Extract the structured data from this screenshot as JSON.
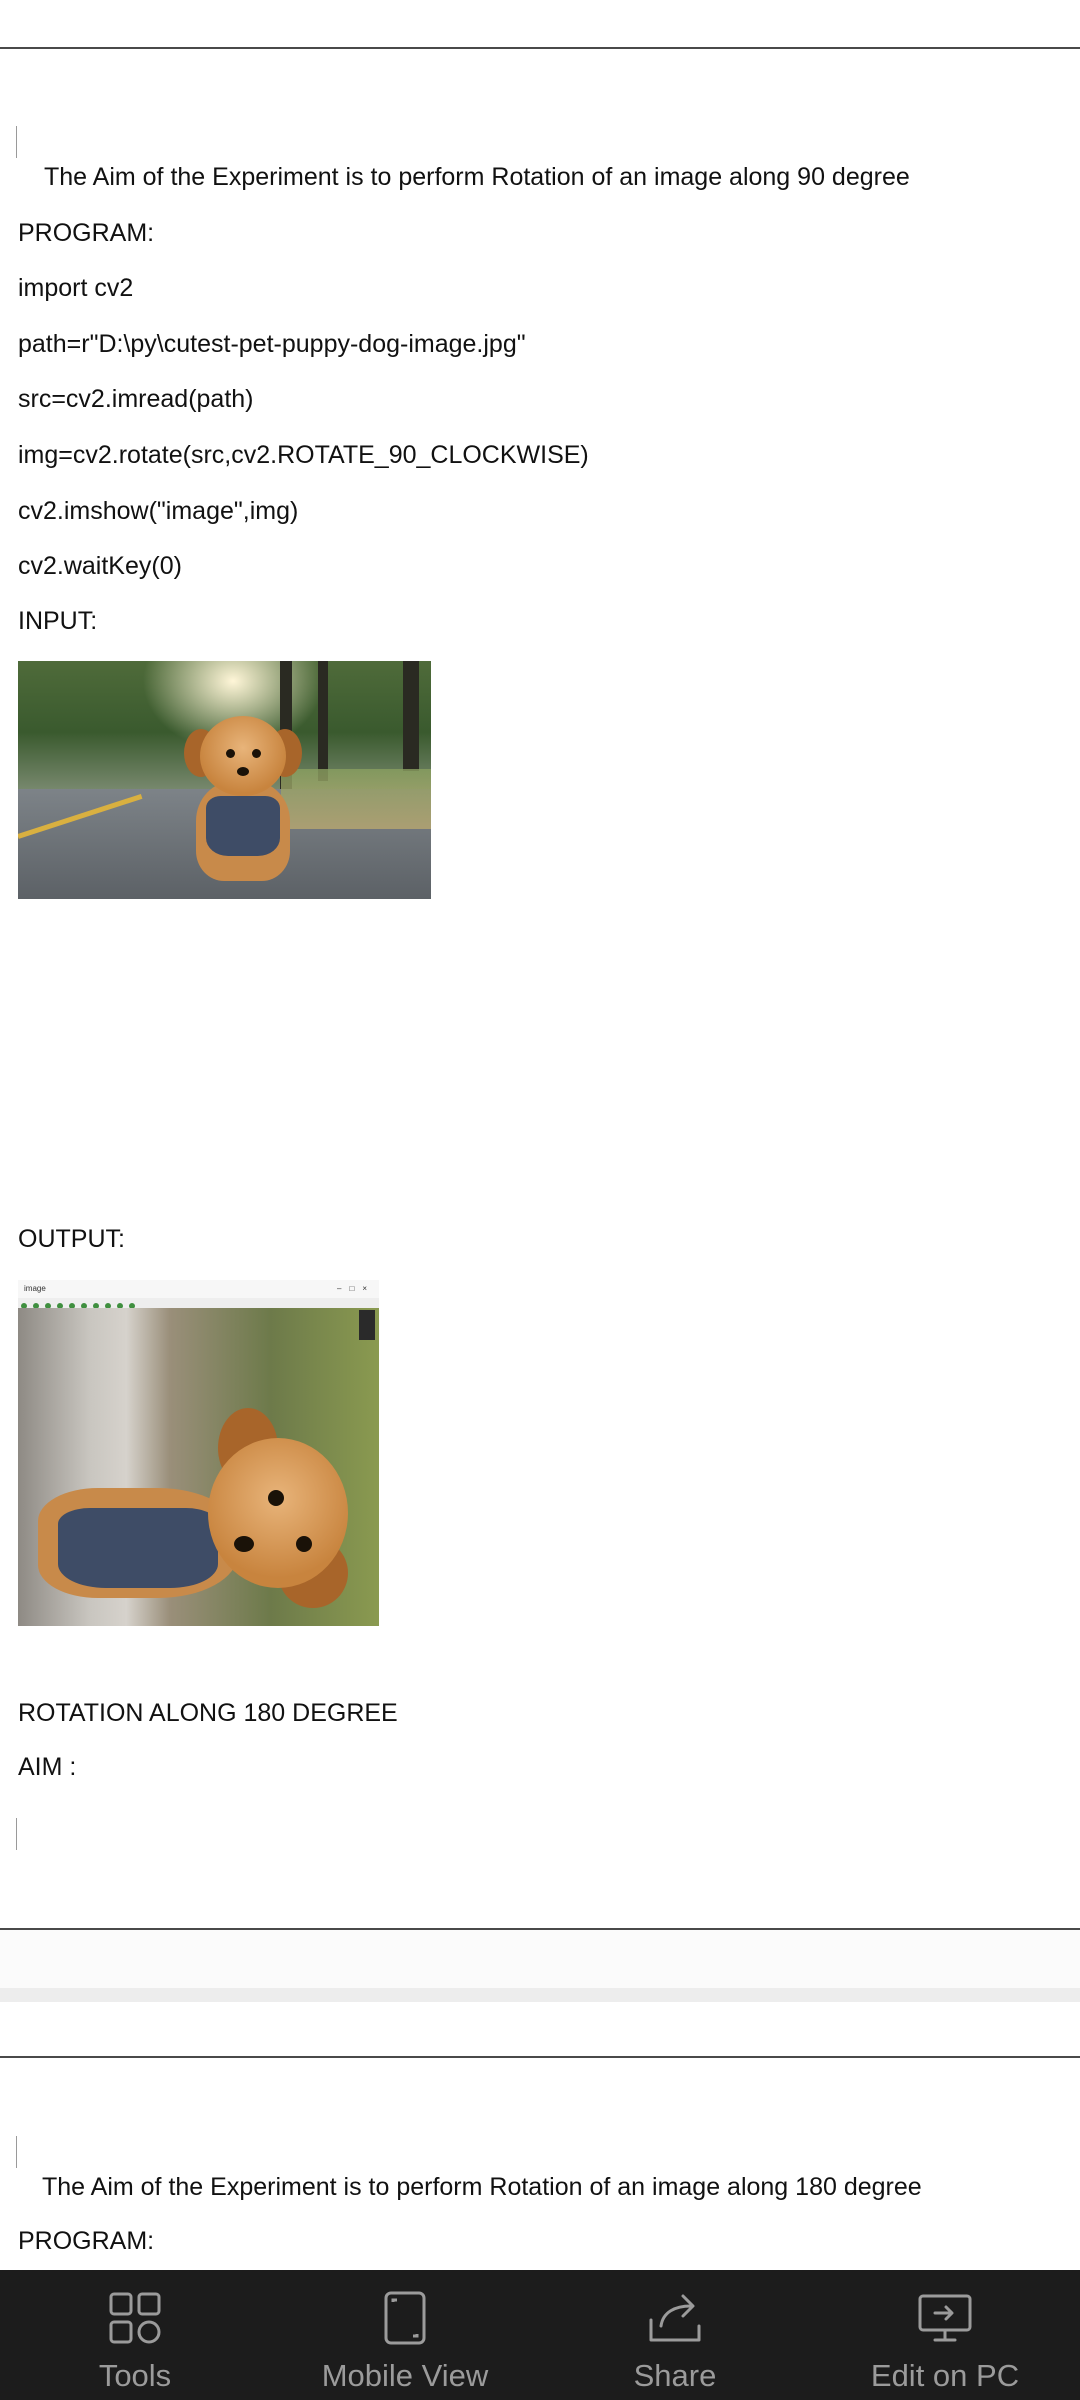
{
  "page1": {
    "aim": "The Aim of the Experiment is to perform Rotation of an image along 90 degree",
    "program_label": "PROGRAM:",
    "code": [
      "import cv2",
      "path=r\"D:\\py\\cutest-pet-puppy-dog-image.jpg\"",
      "src=cv2.imread(path)",
      "img=cv2.rotate(src,cv2.ROTATE_90_CLOCKWISE)",
      "cv2.imshow(\"image\",img)",
      "cv2.waitKey(0)"
    ],
    "input_label": "INPUT:",
    "output_label": "OUTPUT:",
    "output_window_title": "image",
    "next_heading": "ROTATION ALONG 180 DEGREE",
    "aim_label": "AIM :"
  },
  "page2": {
    "aim": "The Aim of the Experiment is to perform Rotation of an image along 180 degree",
    "program_label": "PROGRAM:"
  },
  "bottom_bar": {
    "items": [
      {
        "label": "Tools",
        "icon": "tools-icon"
      },
      {
        "label": "Mobile View",
        "icon": "mobile-view-icon"
      },
      {
        "label": "Share",
        "icon": "share-icon"
      },
      {
        "label": "Edit on PC",
        "icon": "edit-on-pc-icon"
      }
    ]
  },
  "colors": {
    "bottom_bar_bg": "#1c1c1c",
    "bottom_bar_text": "#9b9b9b",
    "page_bg": "#ffffff",
    "page_rule": "#4a4a4a"
  }
}
